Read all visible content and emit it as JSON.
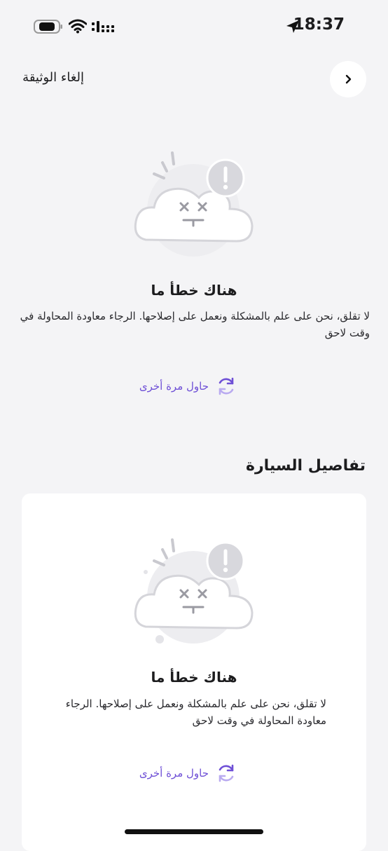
{
  "status_bar": {
    "time": "18:37"
  },
  "header": {
    "cancel_document_label": "إلغاء الوثيقة"
  },
  "error_block_1": {
    "title": "هناك خطأ ما",
    "message": "لا تقلق، نحن على علم بالمشكلة ونعمل على إصلاحها. الرجاء معاودة المحاولة في وقت لاحق",
    "retry_label": "حاول مرة أخرى"
  },
  "car_details": {
    "section_title": "تفاصيل السيارة",
    "error_title": "هناك خطأ ما",
    "error_message": "لا تقلق، نحن على علم بالمشكلة ونعمل على إصلاحها. الرجاء معاودة المحاولة في وقت لاحق",
    "retry_label": "حاول مرة أخرى"
  },
  "colors": {
    "accent": "#6e4fd6",
    "background": "#f4f4f6",
    "card": "#ffffff"
  },
  "icons": [
    "location-arrow-icon",
    "battery-icon",
    "wifi-icon",
    "signal-icon",
    "chevron-right-icon",
    "cloud-error-icon",
    "refresh-icon"
  ]
}
